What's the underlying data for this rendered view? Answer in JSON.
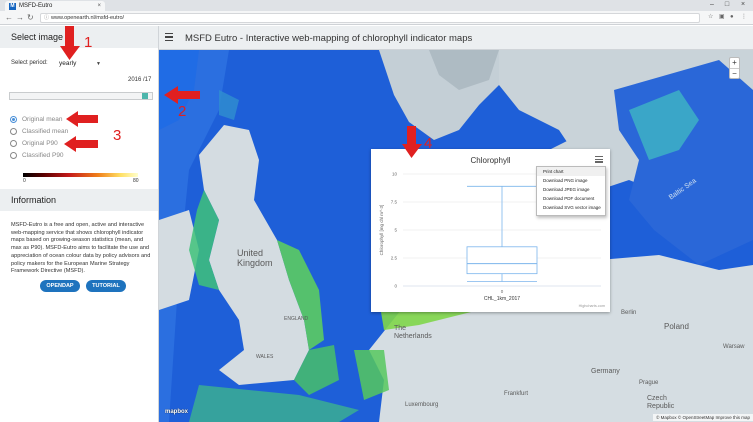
{
  "browser": {
    "tab_title": "MSFD-Eutro",
    "url": "www.openearth.nl/msfd-eutro/"
  },
  "app": {
    "title": "MSFD Eutro - Interactive web-mapping of chlorophyll indicator maps"
  },
  "sidebar": {
    "select_image_title": "Select image",
    "period_label": "Select period:",
    "period_value": "yearly",
    "slider_value_label": "2016 /17",
    "slider_position": 0.97,
    "radios": [
      {
        "label": "Original mean",
        "selected": true
      },
      {
        "label": "Classified mean",
        "selected": false
      },
      {
        "label": "Original P90",
        "selected": false
      },
      {
        "label": "Classified P90",
        "selected": false
      }
    ],
    "legend": {
      "min": "0",
      "max": "80"
    },
    "information_title": "Information",
    "info_text": "MSFD-Eutro is a free and open, active and interactive web-mapping service that shows chlorophyll indicator maps based on growing-season statistics (mean, and max as P90). MSFD-Eutro aims to facilitate the use and appreciation of ocean colour data by policy advisors and policy makers for the European Marine Strategy Framework Directive (MSFD).",
    "buttons": {
      "opendap": "OPENDAP",
      "tutorial": "TUTORIAL"
    }
  },
  "map": {
    "labels": {
      "united_kingdom": "United\nKingdom",
      "england": "ENGLAND",
      "wales": "WALES",
      "netherlands": "The\nNetherlands",
      "berlin": "Berlin",
      "poland": "Poland",
      "baltic_sea": "Baltic Sea",
      "warsaw": "Warsaw",
      "czech": "Czech\nRepublic",
      "germany": "Germany",
      "luxembourg": "Luxembourg",
      "prague": "Prague",
      "frankfurt": "Frankfurt"
    },
    "zoom_in": "+",
    "zoom_out": "−",
    "logo": "mapbox",
    "attribution": "© Mapbox © OpenStreetMap Improve this map"
  },
  "chart_popup": {
    "export_menu": [
      "Print chart",
      "Download PNG image",
      "Download JPEG image",
      "Download PDF document",
      "Download SVG vector image"
    ],
    "credits": "Highcharts.com"
  },
  "chart_data": {
    "type": "boxplot",
    "title": "Chlorophyll",
    "ylabel": "Chlorophyll [mg chl m^-3]",
    "ylim": [
      0,
      10
    ],
    "yticks": [
      0,
      2.5,
      5,
      7.5,
      10
    ],
    "categories": [
      "0"
    ],
    "series": [
      {
        "name": "CHL_1km_2017",
        "low": 0.4,
        "q1": 1.1,
        "median": 2.0,
        "q3": 3.5,
        "high": 8.9
      }
    ],
    "grid": true,
    "legend": "bottom"
  },
  "annotations": [
    "1",
    "2",
    "3",
    "4"
  ],
  "colors": {
    "accent": "#1e73be",
    "slider": "#4db6ac",
    "annotation": "#e02020"
  }
}
